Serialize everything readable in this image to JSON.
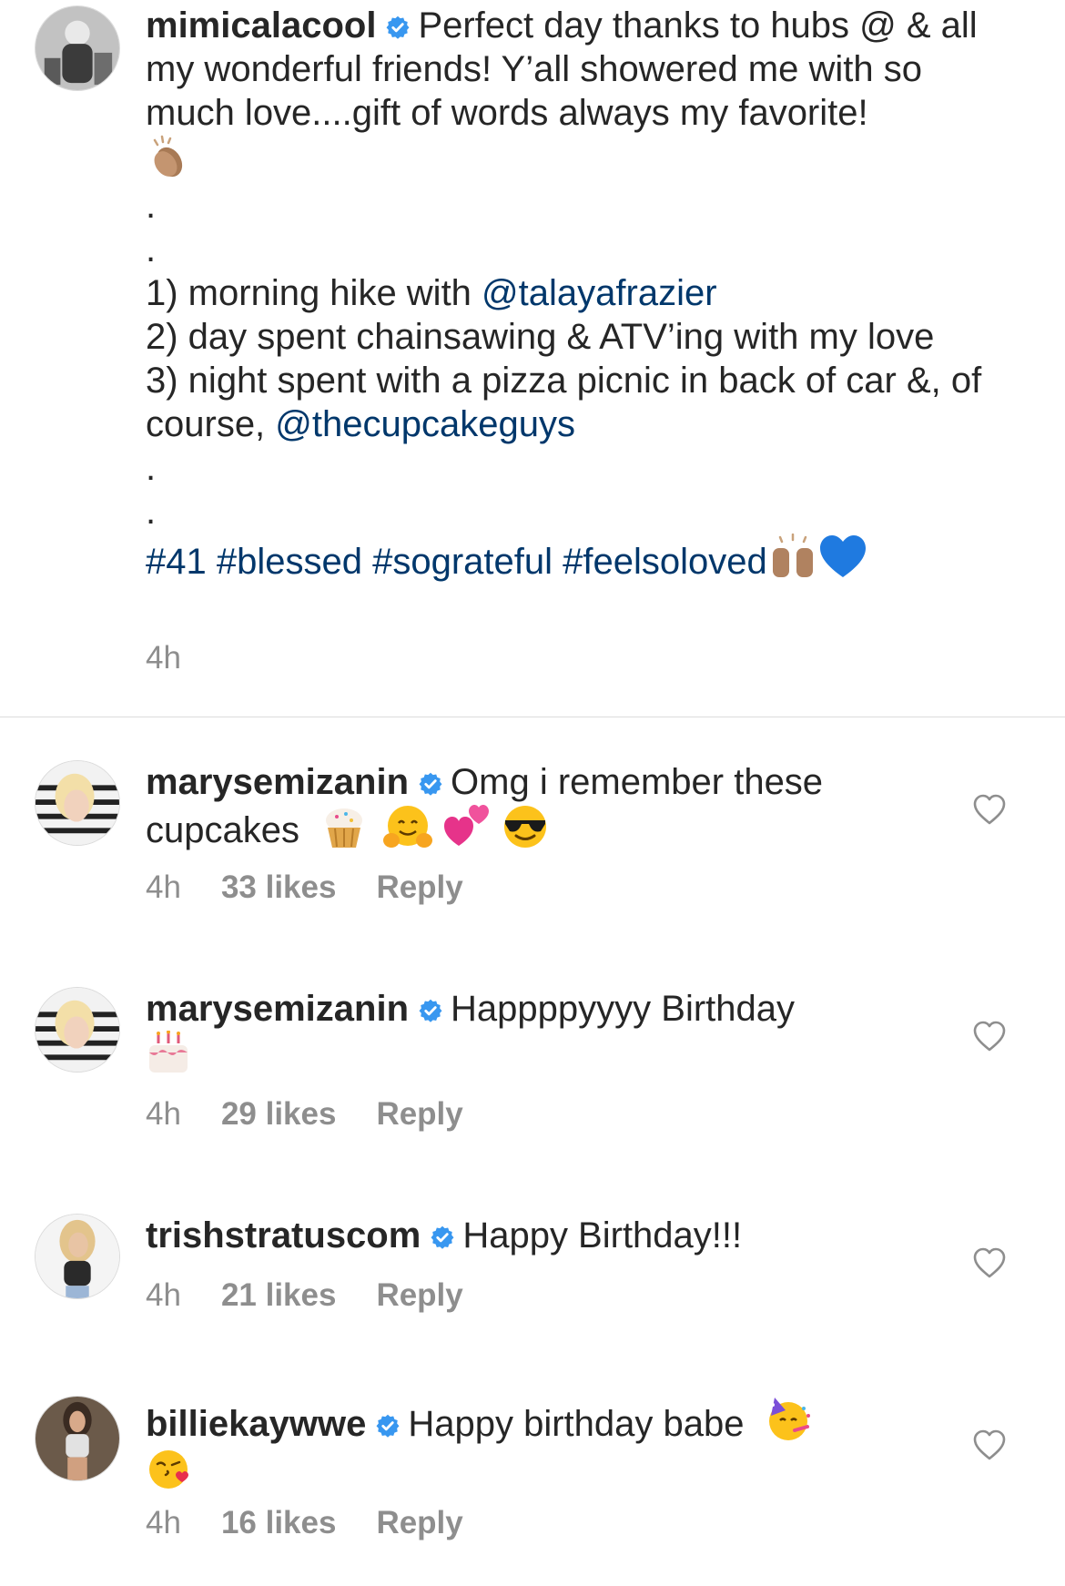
{
  "post": {
    "username": "mimicalacool",
    "caption_intro": "Perfect day thanks to hubs @ & all my wonderful friends! Y’all showered me with so much love....gift of words always my favorite!",
    "dot1": ".",
    "dot2": ".",
    "line1_text": "1) morning hike with ",
    "line1_mention": "@talayafrazier",
    "line2_text": "2) day spent chainsawing & ATV’ing with my love",
    "line3_text": "3) night spent with a pizza picnic in back of car &, of course, ",
    "line3_mention": "@thecupcakeguys",
    "dot3": ".",
    "dot4": ".",
    "hashtags": "#41 #blessed #sograteful #feelsoloved",
    "time": "4h"
  },
  "comments": [
    {
      "username": "marysemizanin",
      "text": "Omg i remember these cupcakes",
      "time": "4h",
      "likes": "33 likes",
      "reply": "Reply"
    },
    {
      "username": "marysemizanin",
      "text": "Happppyyyy Birthday",
      "time": "4h",
      "likes": "29 likes",
      "reply": "Reply"
    },
    {
      "username": "trishstratuscom",
      "text": "Happy Birthday!!!",
      "time": "4h",
      "likes": "21 likes",
      "reply": "Reply"
    },
    {
      "username": "billiekaywwe",
      "text": "Happy birthday babe",
      "time": "4h",
      "likes": "16 likes",
      "reply": "Reply"
    }
  ],
  "icons": {
    "verified": "verified-badge-icon",
    "heart": "heart-outline-icon",
    "clap": "clapping-hands-emoji",
    "raised_hands": "raising-hands-emoji",
    "blue_heart": "blue-heart-emoji",
    "cupcake": "cupcake-emoji",
    "hug": "hugging-face-emoji",
    "two_hearts": "two-hearts-emoji",
    "sunglasses": "sunglasses-face-emoji",
    "cake": "birthday-cake-emoji",
    "party_face": "partying-face-emoji",
    "kiss_face": "face-blowing-kiss-emoji"
  },
  "colors": {
    "text": "#262626",
    "link": "#00376b",
    "meta": "#8e8e8e",
    "verified": "#3897f0",
    "divider": "#dbdbdb"
  }
}
